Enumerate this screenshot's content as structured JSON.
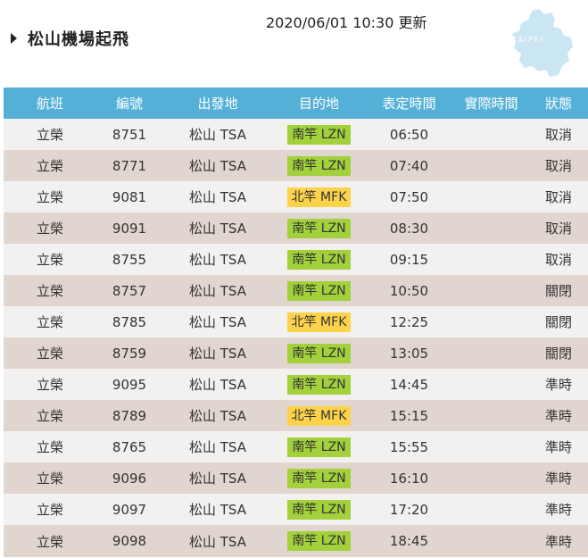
{
  "page": {
    "title": "松山機場起飛",
    "updated": "2020/06/01 10:30 更新",
    "logo_text": "TAIPEI"
  },
  "colors": {
    "header_bg": "#55b0d8",
    "row_odd": "#f3f1ef",
    "row_even": "#e0d6cf",
    "dest_lzn": "#a2d13b",
    "dest_mfk": "#fdd34c",
    "logo_map": "#c9e6f2"
  },
  "icons": {
    "title_marker": "triangle-right-icon",
    "logo": "taipei-map-logo"
  },
  "columns": [
    "航班",
    "編號",
    "出發地",
    "目的地",
    "表定時間",
    "實際時間",
    "狀態"
  ],
  "flights": [
    {
      "airline": "立榮",
      "number": "8751",
      "from": "松山 TSA",
      "to": "南竿 LZN",
      "to_color": "green",
      "scheduled": "06:50",
      "actual": "",
      "status": "取消"
    },
    {
      "airline": "立榮",
      "number": "8771",
      "from": "松山 TSA",
      "to": "南竿 LZN",
      "to_color": "green",
      "scheduled": "07:40",
      "actual": "",
      "status": "取消"
    },
    {
      "airline": "立榮",
      "number": "9081",
      "from": "松山 TSA",
      "to": "北竿 MFK",
      "to_color": "yellow",
      "scheduled": "07:50",
      "actual": "",
      "status": "取消"
    },
    {
      "airline": "立榮",
      "number": "9091",
      "from": "松山 TSA",
      "to": "南竿 LZN",
      "to_color": "green",
      "scheduled": "08:30",
      "actual": "",
      "status": "取消"
    },
    {
      "airline": "立榮",
      "number": "8755",
      "from": "松山 TSA",
      "to": "南竿 LZN",
      "to_color": "green",
      "scheduled": "09:15",
      "actual": "",
      "status": "取消"
    },
    {
      "airline": "立榮",
      "number": "8757",
      "from": "松山 TSA",
      "to": "南竿 LZN",
      "to_color": "green",
      "scheduled": "10:50",
      "actual": "",
      "status": "關閉"
    },
    {
      "airline": "立榮",
      "number": "8785",
      "from": "松山 TSA",
      "to": "北竿 MFK",
      "to_color": "yellow",
      "scheduled": "12:25",
      "actual": "",
      "status": "關閉"
    },
    {
      "airline": "立榮",
      "number": "8759",
      "from": "松山 TSA",
      "to": "南竿 LZN",
      "to_color": "green",
      "scheduled": "13:05",
      "actual": "",
      "status": "關閉"
    },
    {
      "airline": "立榮",
      "number": "9095",
      "from": "松山 TSA",
      "to": "南竿 LZN",
      "to_color": "green",
      "scheduled": "14:45",
      "actual": "",
      "status": "準時"
    },
    {
      "airline": "立榮",
      "number": "8789",
      "from": "松山 TSA",
      "to": "北竿 MFK",
      "to_color": "yellow",
      "scheduled": "15:15",
      "actual": "",
      "status": "準時"
    },
    {
      "airline": "立榮",
      "number": "8765",
      "from": "松山 TSA",
      "to": "南竿 LZN",
      "to_color": "green",
      "scheduled": "15:55",
      "actual": "",
      "status": "準時"
    },
    {
      "airline": "立榮",
      "number": "9096",
      "from": "松山 TSA",
      "to": "南竿 LZN",
      "to_color": "green",
      "scheduled": "16:10",
      "actual": "",
      "status": "準時"
    },
    {
      "airline": "立榮",
      "number": "9097",
      "from": "松山 TSA",
      "to": "南竿 LZN",
      "to_color": "green",
      "scheduled": "17:20",
      "actual": "",
      "status": "準時"
    },
    {
      "airline": "立榮",
      "number": "9098",
      "from": "松山 TSA",
      "to": "南竿 LZN",
      "to_color": "green",
      "scheduled": "18:45",
      "actual": "",
      "status": "準時"
    }
  ]
}
